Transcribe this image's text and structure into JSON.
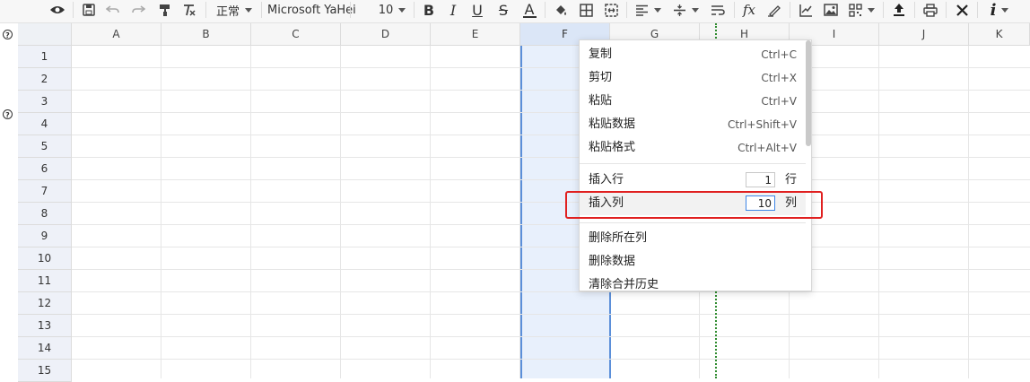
{
  "toolbar": {
    "style_select": "正常",
    "font_select": "Microsoft YaHei",
    "size_select": "10",
    "bold": "B",
    "italic": "I",
    "underline": "U",
    "strike": "S",
    "font_color_letter": "A",
    "font_color": "#333333",
    "fx": "fx"
  },
  "gutter": {
    "help_glyph": "?"
  },
  "grid": {
    "columns": [
      "A",
      "B",
      "C",
      "D",
      "E",
      "F",
      "G",
      "H",
      "I",
      "J",
      "K"
    ],
    "selected_column": "F",
    "rows": [
      "1",
      "2",
      "3",
      "4",
      "5",
      "6",
      "7",
      "8",
      "9",
      "10",
      "11",
      "12",
      "13",
      "14",
      "15"
    ]
  },
  "context_menu": {
    "copy": {
      "label": "复制",
      "shortcut": "Ctrl+C"
    },
    "cut": {
      "label": "剪切",
      "shortcut": "Ctrl+X"
    },
    "paste": {
      "label": "粘贴",
      "shortcut": "Ctrl+V"
    },
    "paste_data": {
      "label": "粘贴数据",
      "shortcut": "Ctrl+Shift+V"
    },
    "paste_format": {
      "label": "粘贴格式",
      "shortcut": "Ctrl+Alt+V"
    },
    "insert_row": {
      "label": "插入行",
      "value": "1",
      "unit": "行"
    },
    "insert_col": {
      "label": "插入列",
      "value": "10",
      "unit": "列"
    },
    "delete_col": {
      "label": "删除所在列"
    },
    "delete_data": {
      "label": "删除数据"
    },
    "clear_merge": {
      "label": "清除合并历史"
    }
  },
  "colors": {
    "highlight_box": "#e02020",
    "selection": "#5b8fd9",
    "dotted_line": "#2e8b2e"
  }
}
